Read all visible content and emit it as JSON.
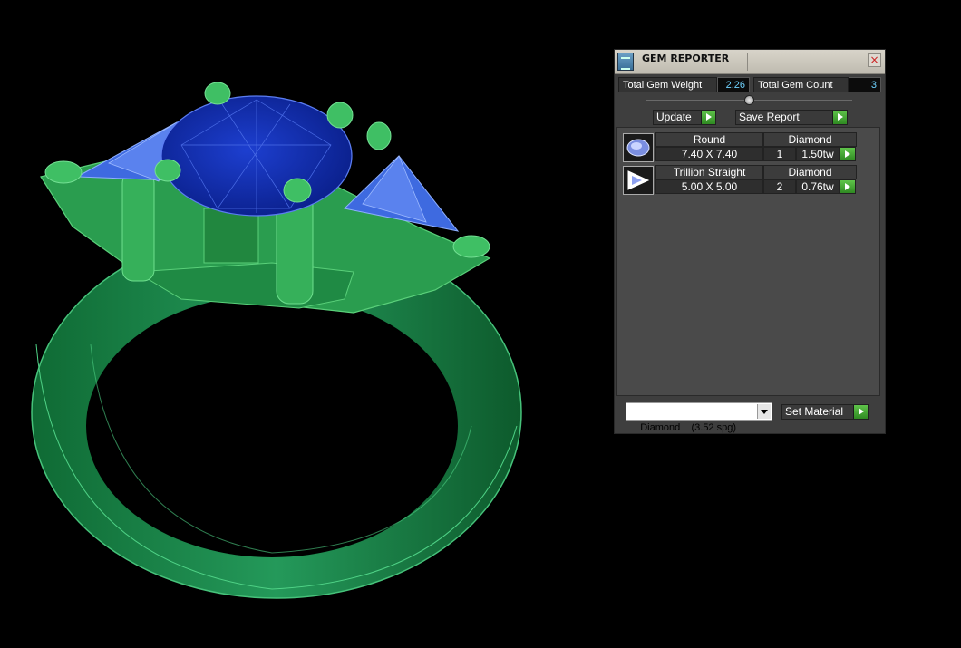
{
  "window": {
    "title": "GEM REPORTER",
    "close_glyph": "×"
  },
  "summary": {
    "weight_label": "Total Gem Weight",
    "weight_value": "2.26",
    "count_label": "Total Gem Count",
    "count_value": "3"
  },
  "actions": {
    "update_label": "Update",
    "save_label": "Save Report"
  },
  "gems": [
    {
      "shape": "Round",
      "material": "Diamond",
      "size": "7.40 X 7.40",
      "qty": "1",
      "weight": "1.50tw",
      "thumb_icon": "round-gem-icon"
    },
    {
      "shape": "Trillion Straight",
      "material": "Diamond",
      "size": "5.00 X 5.00",
      "qty": "2",
      "weight": "0.76tw",
      "thumb_icon": "trillion-gem-icon"
    }
  ],
  "material": {
    "selected": "Diamond    (3.52 spg)",
    "set_label": "Set Material"
  },
  "colors": {
    "ring_green": "#1f8a4c",
    "gem_blue": "#1535b8",
    "accent_green": "#3fae2f",
    "value_cyan": "#6fd3ff"
  }
}
